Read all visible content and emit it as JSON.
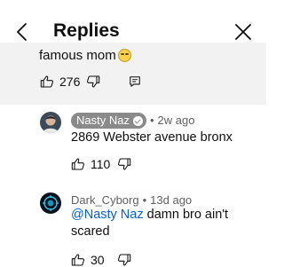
{
  "header": {
    "title": "Replies"
  },
  "parent_comment": {
    "text_tail": "famous mom",
    "emoji": "flushed-face",
    "like_count": "276"
  },
  "replies": [
    {
      "author": "Nasty Naz",
      "verified": true,
      "time": "2w ago",
      "text": "2869 Webster avenue bronx",
      "like_count": "110"
    },
    {
      "author": "Dark_Cyborg",
      "time": "13d ago",
      "mention": "@Nasty Naz",
      "text": " damn bro ain't scared",
      "like_count": "30"
    }
  ],
  "separator": "•",
  "colors": {
    "background": "#ffffff",
    "parent_background": "#f2f2f2",
    "mention": "#065fd4",
    "author_chip": "#8a8a8a",
    "secondary_text": "#606060"
  },
  "icons": [
    "back-arrow-icon",
    "close-icon",
    "thumb-up-icon",
    "thumb-down-icon",
    "reply-icon"
  ]
}
